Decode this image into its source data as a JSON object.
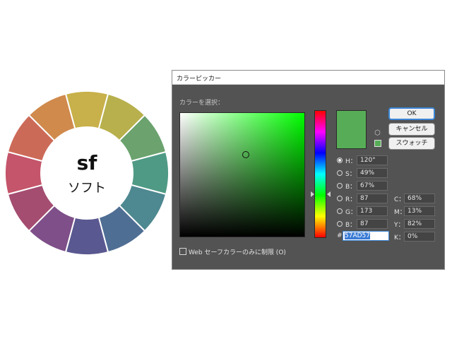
{
  "wheel": {
    "main_text": "sf",
    "sub_text": "ソフト",
    "segment_colors": [
      "#c8b04a",
      "#b8b04c",
      "#6ba26e",
      "#4f9a85",
      "#4e8890",
      "#4f6e94",
      "#5a5890",
      "#7e4f88",
      "#a44d70",
      "#c4556a",
      "#cc6a58",
      "#d08a4c"
    ]
  },
  "dialog": {
    "title": "カラーピッカー",
    "select_label": "カラーを選択：",
    "buttons": {
      "ok": "OK",
      "cancel": "キャンセル",
      "swatches": "スウォッチ"
    },
    "hsb": [
      {
        "label": "H：",
        "value": "120°",
        "selected": true
      },
      {
        "label": "S：",
        "value": "49%",
        "selected": false
      },
      {
        "label": "B：",
        "value": "67%",
        "selected": false
      }
    ],
    "rgb": [
      {
        "label": "R：",
        "value": "87",
        "selected": false
      },
      {
        "label": "G：",
        "value": "173",
        "selected": false
      },
      {
        "label": "B：",
        "value": "87",
        "selected": false
      }
    ],
    "cmyk": [
      {
        "label": "C：",
        "value": "68%"
      },
      {
        "label": "M：",
        "value": "13%"
      },
      {
        "label": "Y：",
        "value": "82%"
      },
      {
        "label": "K：",
        "value": "0%"
      }
    ],
    "hex_label": "#",
    "hex_value": "57AD57",
    "web_only_label": "Web セーフカラーのみに制限 (O)",
    "web_only_checked": false,
    "current_color": "#57ad57"
  }
}
